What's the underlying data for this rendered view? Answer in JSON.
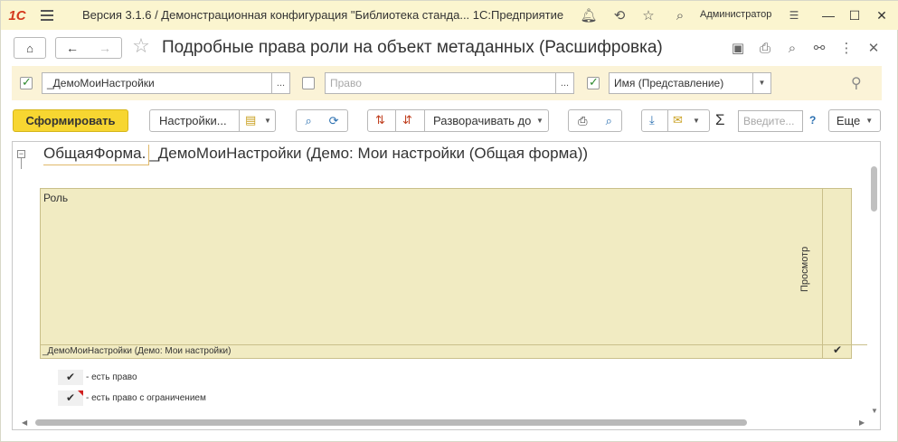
{
  "app": {
    "logo": "1С",
    "title": "Версия 3.1.6 / Демонстрационная конфигурация \"Библиотека станда...  1С:Предприятие",
    "user": "Администратор"
  },
  "nav": {
    "form_title": "Подробные права роли на объект метаданных (Расшифровка)"
  },
  "filters": {
    "role_value": "_ДемоМоиНастройки",
    "role_checked": true,
    "right_placeholder": "Право",
    "right_checked": false,
    "name_mode_value": "Имя (Представление)",
    "name_mode_checked": true,
    "dots": "..."
  },
  "toolbar": {
    "generate_label": "Сформировать",
    "settings_label": "Настройки...",
    "expand_label": "Разворачивать до",
    "search_placeholder": "Введите...",
    "help_label": "?",
    "more_label": "Еще",
    "sum_label": "Σ"
  },
  "report": {
    "object_prefix": "ОбщаяФорма.",
    "object_rest": "_ДемоМоиНастройки (Демо: Мои настройки (Общая форма))",
    "column_role": "Роль",
    "column_right": "Просмотр",
    "rows": [
      {
        "role": "_ДемоМоиНастройки (Демо: Мои настройки)",
        "view": "✔"
      }
    ],
    "legend": [
      {
        "mark": "✔",
        "text": "- есть право"
      },
      {
        "mark": "✔",
        "text": "- есть право с ограничением"
      }
    ]
  }
}
